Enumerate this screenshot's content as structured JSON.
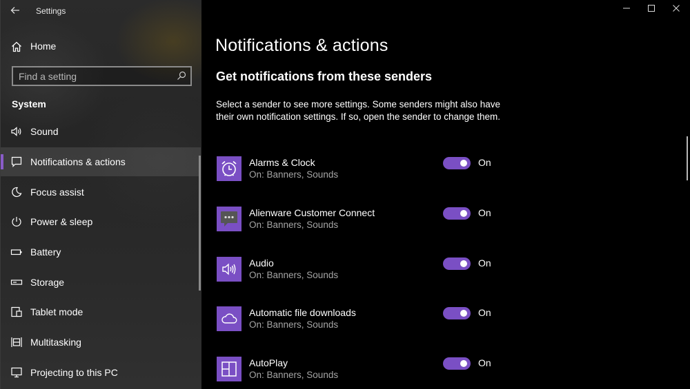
{
  "window": {
    "title": "Settings",
    "back_icon": "back-arrow-icon",
    "controls": {
      "minimize": "–",
      "maximize": "☐",
      "close": "✕"
    }
  },
  "sidebar": {
    "home_label": "Home",
    "search_placeholder": "Find a setting",
    "section_label": "System",
    "items": [
      {
        "label": "Sound",
        "icon": "speaker-icon",
        "selected": false
      },
      {
        "label": "Notifications & actions",
        "icon": "notification-icon",
        "selected": true
      },
      {
        "label": "Focus assist",
        "icon": "moon-icon",
        "selected": false
      },
      {
        "label": "Power & sleep",
        "icon": "power-icon",
        "selected": false
      },
      {
        "label": "Battery",
        "icon": "battery-icon",
        "selected": false
      },
      {
        "label": "Storage",
        "icon": "storage-icon",
        "selected": false
      },
      {
        "label": "Tablet mode",
        "icon": "tablet-mode-icon",
        "selected": false
      },
      {
        "label": "Multitasking",
        "icon": "multitasking-icon",
        "selected": false
      },
      {
        "label": "Projecting to this PC",
        "icon": "projecting-icon",
        "selected": false
      }
    ]
  },
  "main": {
    "page_title": "Notifications & actions",
    "section_title": "Get notifications from these senders",
    "description": "Select a sender to see more settings. Some senders might also have their own notification settings. If so, open the sender to change them.",
    "senders": [
      {
        "name": "Alarms & Clock",
        "sub": "On: Banners, Sounds",
        "toggle": "On",
        "icon": "alarm-clock-icon"
      },
      {
        "name": "Alienware Customer Connect",
        "sub": "On: Banners, Sounds",
        "toggle": "On",
        "icon": "chat-bubble-icon"
      },
      {
        "name": "Audio",
        "sub": "On: Banners, Sounds",
        "toggle": "On",
        "icon": "speaker-icon"
      },
      {
        "name": "Automatic file downloads",
        "sub": "On: Banners, Sounds",
        "toggle": "On",
        "icon": "cloud-icon"
      },
      {
        "name": "AutoPlay",
        "sub": "On: Banners, Sounds",
        "toggle": "On",
        "icon": "autoplay-icon"
      }
    ]
  },
  "colors": {
    "accent": "#7a4fc4",
    "background": "#000000",
    "sidebar": "#2a2a2a",
    "subtext": "#a6a6a6"
  }
}
